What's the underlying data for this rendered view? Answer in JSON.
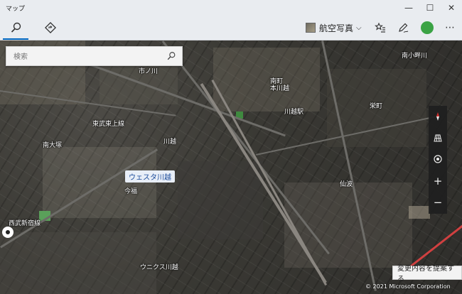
{
  "window": {
    "title": "マップ"
  },
  "toolbar": {
    "map_view_label": "航空写真",
    "icons": [
      "search-icon",
      "directions-icon",
      "favorites-icon",
      "ink-icon",
      "more-icon"
    ],
    "avatar_initial": "",
    "accent_color": "#0067c0"
  },
  "search": {
    "placeholder": "検索"
  },
  "map": {
    "labels": [
      "南小畔川",
      "南町",
      "市ノ川",
      "栄町",
      "東武東上線",
      "今福",
      "西武新宿線",
      "川越",
      "川越駅",
      "ウニクス川越",
      "本川越",
      "仙波",
      "南大塚"
    ],
    "station_highlight": "ウェスタ川越",
    "controls": [
      "compass",
      "3d-cities",
      "my-location",
      "zoom-in",
      "zoom-out"
    ]
  },
  "footer": {
    "suggest_edit": "変更内容を提案する",
    "copyright": "© 2021 Microsoft Corporation"
  }
}
